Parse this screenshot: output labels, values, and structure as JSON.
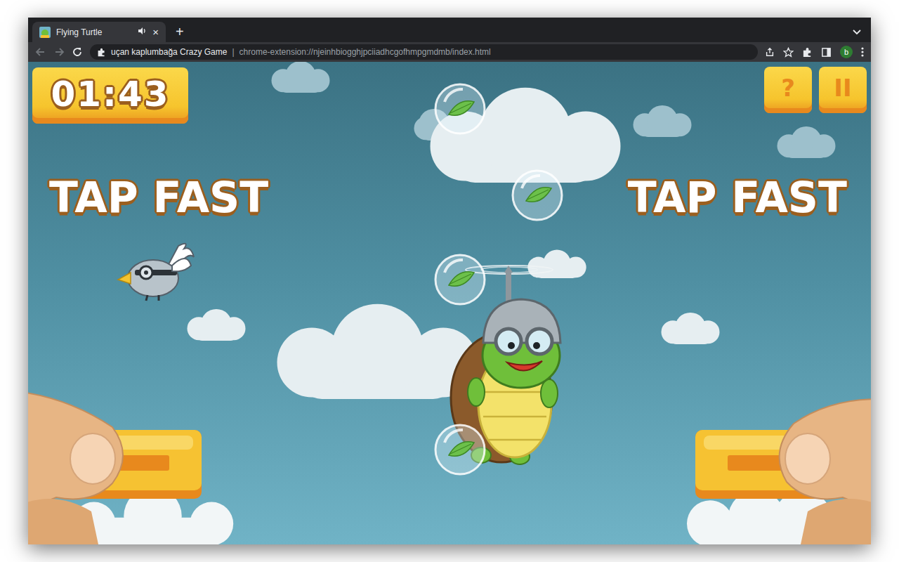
{
  "browser": {
    "tab": {
      "title": "Flying Turtle",
      "close": "×",
      "selected": true,
      "audio_playing": true
    },
    "new_tab": "+",
    "address": {
      "site": "uçan kaplumbağa Crazy Game",
      "separator": "|",
      "url": "chrome-extension://njeinhbiogghjpciiadhcgofhmpgmdmb/index.html"
    },
    "profile": "b"
  },
  "game": {
    "timer": "01:43",
    "help_button": "?",
    "pause_button": "II",
    "hints": [
      "TAP FAST",
      "TAP FAST"
    ]
  }
}
